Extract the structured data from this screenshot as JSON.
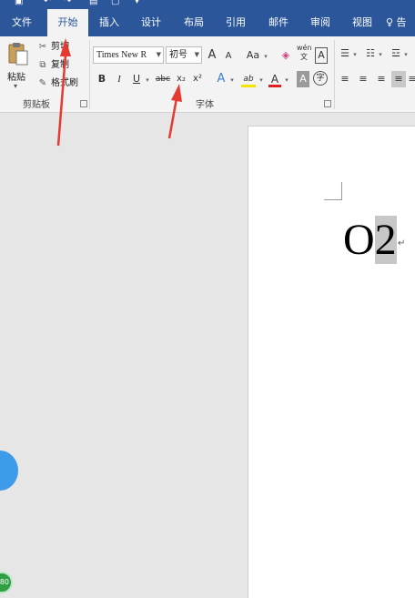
{
  "tabs": [
    {
      "label": "文件"
    },
    {
      "label": "开始"
    },
    {
      "label": "插入"
    },
    {
      "label": "设计"
    },
    {
      "label": "布局"
    },
    {
      "label": "引用"
    },
    {
      "label": "邮件"
    },
    {
      "label": "审阅"
    },
    {
      "label": "视图"
    }
  ],
  "tell_me_label": "♀ 告",
  "clipboard": {
    "paste_label": "粘贴",
    "cut_label": "剪切",
    "copy_label": "复制",
    "format_painter_label": "格式刷",
    "group_label": "剪贴板"
  },
  "font": {
    "font_name": "Times New R",
    "font_size": "初号",
    "group_label": "字体",
    "grow_label": "A",
    "shrink_label": "A",
    "case_label": "Aa",
    "wen_label": "wén\n文",
    "bold_label": "B",
    "italic_label": "I",
    "underline_label": "U",
    "strike_label": "abc",
    "subscript_label": "x₂",
    "superscript_label": "x²",
    "effect_label": "A",
    "highlight_label": "ab",
    "color_label": "A",
    "shade_label": "A",
    "enclose_label": "字"
  },
  "document": {
    "text_main": "O",
    "text_selected": "2",
    "para_mark": "↵"
  },
  "badge_text": "80",
  "colors": {
    "ribbon_blue": "#2b579a",
    "arrow_red": "#e53a32",
    "selection_gray": "#c7c7c7"
  }
}
